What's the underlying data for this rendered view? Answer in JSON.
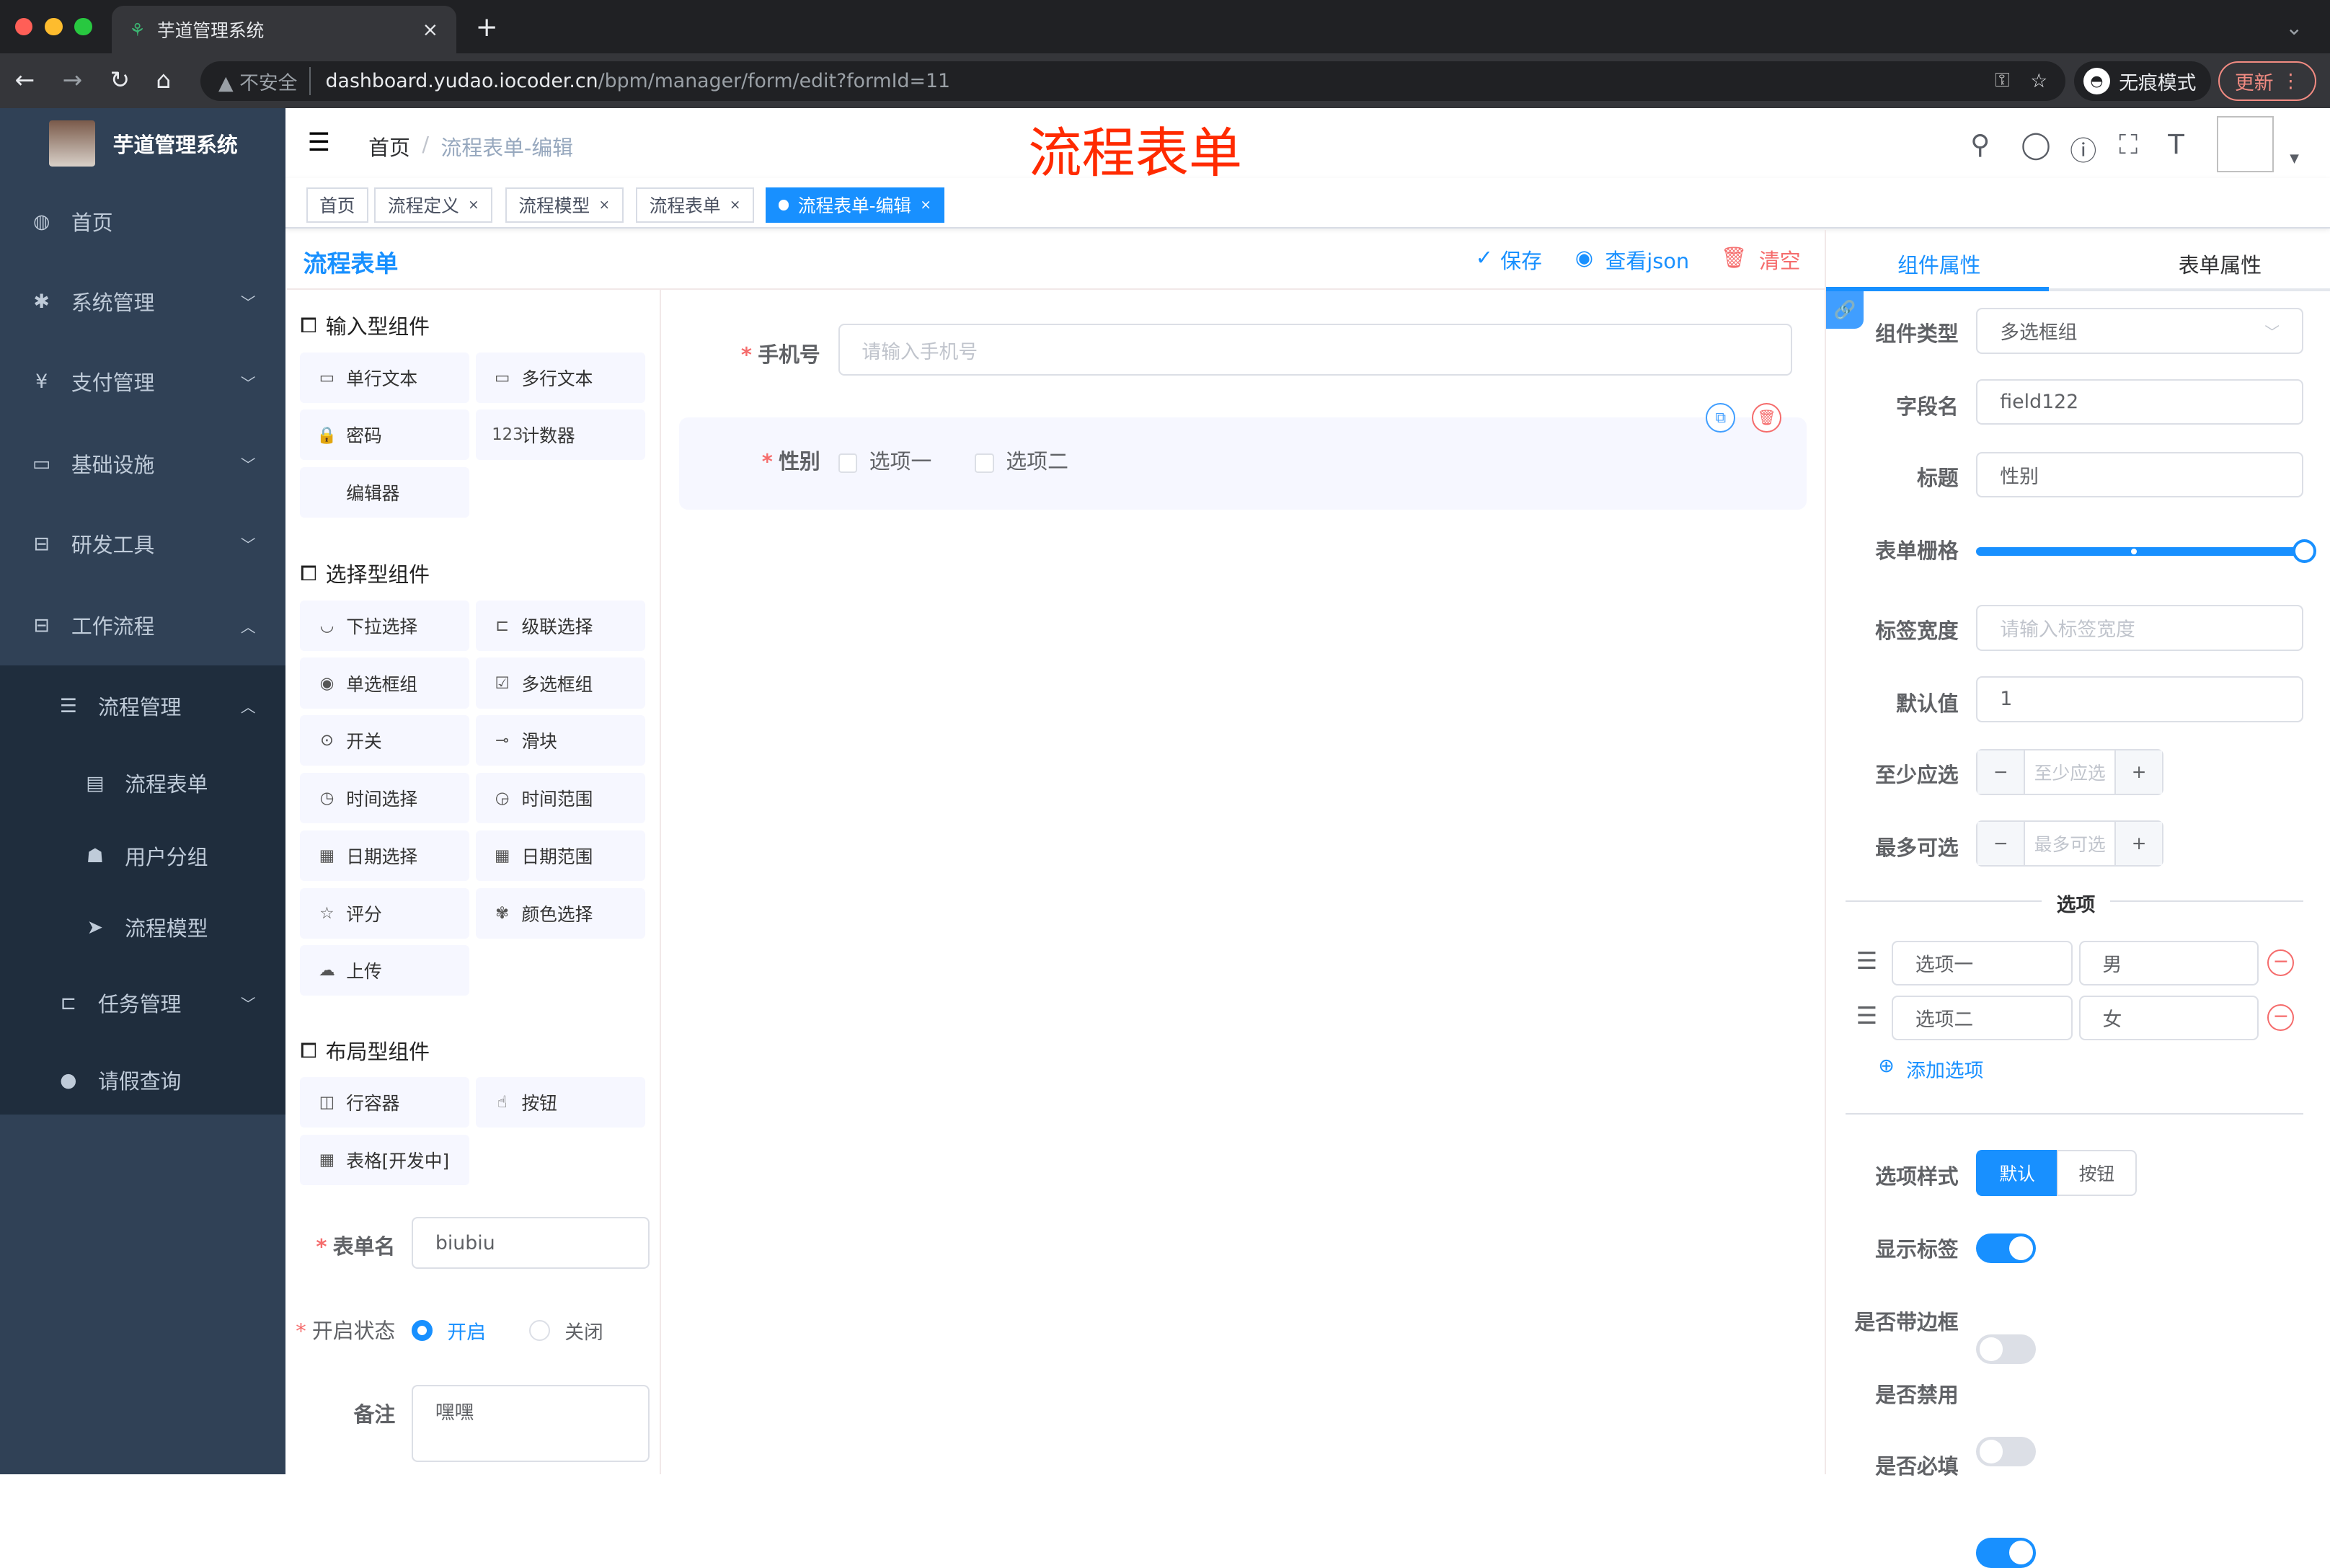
{
  "browser": {
    "tab_title": "芋道管理系统",
    "tab_close": "×",
    "new_tab": "+",
    "insecure": "不安全",
    "url_host": "dashboard.yudao.iocoder.cn",
    "url_path": "/bpm/manager/form/edit?formId=11",
    "incognito": "无痕模式",
    "update": "更新",
    "menu": "⋮",
    "expand": "⌄"
  },
  "sidebar": {
    "logo_title": "芋道管理系统",
    "items": [
      {
        "label": "首页",
        "icon": "dashboard-icon"
      },
      {
        "label": "系统管理",
        "icon": "gear-icon"
      },
      {
        "label": "支付管理",
        "icon": "yen-icon"
      },
      {
        "label": "基础设施",
        "icon": "monitor-icon"
      },
      {
        "label": "研发工具",
        "icon": "toolbox-icon"
      },
      {
        "label": "工作流程",
        "icon": "toolbox-icon"
      },
      {
        "label": "流程管理",
        "icon": "tree-icon"
      },
      {
        "label": "流程表单",
        "icon": "form-icon"
      },
      {
        "label": "用户分组",
        "icon": "group-icon"
      },
      {
        "label": "流程模型",
        "icon": "send-icon"
      },
      {
        "label": "任务管理",
        "icon": "tree-icon"
      },
      {
        "label": "请假查询",
        "icon": "user-icon"
      }
    ]
  },
  "header": {
    "breadcrumb": [
      "首页",
      "流程表单-编辑"
    ],
    "separator": "/",
    "overlay_title": "流程表单",
    "accent": "#1890ff",
    "overlay_color": "#ff2a00"
  },
  "tags": [
    {
      "label": "首页"
    },
    {
      "label": "流程定义",
      "close": "×"
    },
    {
      "label": "流程模型",
      "close": "×"
    },
    {
      "label": "流程表单",
      "close": "×"
    },
    {
      "label": "流程表单-编辑",
      "close": "×",
      "active": true
    }
  ],
  "toolbar": {
    "title": "流程表单",
    "save": "保存",
    "view_json": "查看json",
    "clear": "清空"
  },
  "components": {
    "groups": [
      {
        "title": "输入型组件",
        "items": [
          {
            "label": "单行文本",
            "icon": "input-icon"
          },
          {
            "label": "多行文本",
            "icon": "textarea-icon"
          },
          {
            "label": "密码",
            "icon": "lock-icon"
          },
          {
            "label": "计数器",
            "icon": "number-icon",
            "glyph": "123"
          },
          {
            "label": "编辑器",
            "icon": ""
          }
        ]
      },
      {
        "title": "选择型组件",
        "items": [
          {
            "label": "下拉选择",
            "icon": "select-icon"
          },
          {
            "label": "级联选择",
            "icon": "cascader-icon"
          },
          {
            "label": "单选框组",
            "icon": "radio-icon"
          },
          {
            "label": "多选框组",
            "icon": "checkbox-icon"
          },
          {
            "label": "开关",
            "icon": "switch-icon"
          },
          {
            "label": "滑块",
            "icon": "slider-icon"
          },
          {
            "label": "时间选择",
            "icon": "clock-icon"
          },
          {
            "label": "时间范围",
            "icon": "time-range-icon"
          },
          {
            "label": "日期选择",
            "icon": "calendar-icon"
          },
          {
            "label": "日期范围",
            "icon": "date-range-icon"
          },
          {
            "label": "评分",
            "icon": "star-icon"
          },
          {
            "label": "颜色选择",
            "icon": "palette-icon"
          },
          {
            "label": "上传",
            "icon": "upload-icon"
          }
        ]
      },
      {
        "title": "布局型组件",
        "items": [
          {
            "label": "行容器",
            "icon": "row-icon"
          },
          {
            "label": "按钮",
            "icon": "button-icon"
          },
          {
            "label": "表格[开发中]",
            "icon": "table-icon"
          }
        ]
      }
    ]
  },
  "form_meta": {
    "name_label": "表单名",
    "name_value": "biubiu",
    "status_label": "开启状态",
    "status_on": "开启",
    "status_off": "关闭",
    "remark_label": "备注",
    "remark_value": "嘿嘿"
  },
  "canvas": {
    "phone_label": "手机号",
    "phone_placeholder": "请输入手机号",
    "gender_label": "性别",
    "options": [
      "选项一",
      "选项二"
    ]
  },
  "props": {
    "tabs": [
      "组件属性",
      "表单属性"
    ],
    "type_label": "组件类型",
    "type_value": "多选框组",
    "field_label": "字段名",
    "field_value": "field122",
    "title_label": "标题",
    "title_value": "性别",
    "span_label": "表单栅格",
    "span_value": 24,
    "span_max": 24,
    "label_width_label": "标签宽度",
    "label_width_placeholder": "请输入标签宽度",
    "default_label": "默认值",
    "default_value": "1",
    "min_label": "至少应选",
    "min_placeholder": "至少应选",
    "max_label": "最多可选",
    "max_placeholder": "最多可选",
    "minus": "−",
    "plus": "+",
    "options_title": "选项",
    "options": [
      {
        "label": "选项一",
        "value": "男"
      },
      {
        "label": "选项二",
        "value": "女"
      }
    ],
    "add_option": "添加选项",
    "style_label": "选项样式",
    "style_default": "默认",
    "style_button": "按钮",
    "show_label": "显示标签",
    "show_label_on": true,
    "border_label": "是否带边框",
    "border_on": false,
    "disabled_label": "是否禁用",
    "disabled_on": false,
    "required_label": "是否必填",
    "required_on": true
  }
}
